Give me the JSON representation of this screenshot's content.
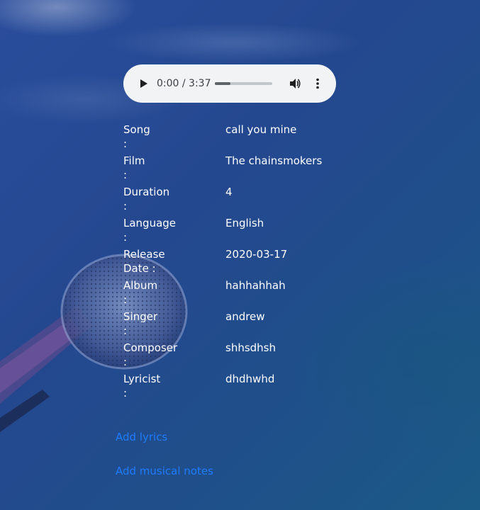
{
  "player": {
    "time": "0:00 / 3:37",
    "progress": 0.27,
    "play_icon": "play-icon",
    "volume_icon": "volume-icon",
    "more_icon": "more-vert-icon"
  },
  "details": [
    {
      "label": "Song :",
      "value": "call you mine"
    },
    {
      "label": "Film :",
      "value": "The chainsmokers"
    },
    {
      "label": "Duration :",
      "value": "4"
    },
    {
      "label": "Language :",
      "value": "English"
    },
    {
      "label": "Release Date :",
      "value": "2020-03-17"
    },
    {
      "label": "Album :",
      "value": "hahhahhah"
    },
    {
      "label": "Singer :",
      "value": "andrew"
    },
    {
      "label": "Composer :",
      "value": "shhsdhsh"
    },
    {
      "label": "Lyricist :",
      "value": "dhdhwhd"
    }
  ],
  "links": {
    "add_lyrics": "Add lyrics",
    "add_notes": "Add musical notes"
  },
  "colors": {
    "link": "#1e7cff",
    "text": "#ffffff",
    "background": "#24488f"
  }
}
